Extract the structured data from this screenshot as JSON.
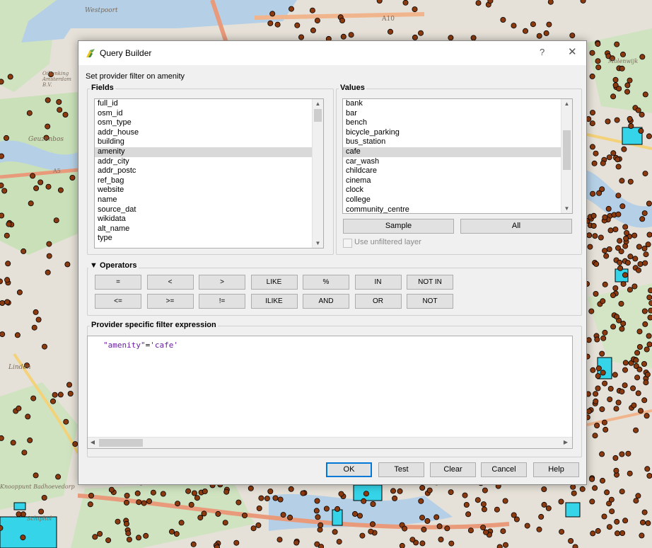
{
  "map": {
    "labels": [
      "Westpoort",
      "Oiltanking Amsterdam B.V.",
      "A10",
      "A5",
      "Geuzenbos",
      "Linden",
      "Knooppunt Badhoevedorp",
      "Schiphol",
      "Molenwijk"
    ]
  },
  "dialog": {
    "title": "Query Builder",
    "help_label": "?",
    "close_label": "✕",
    "subtitle": "Set provider filter on amenity",
    "fields": {
      "label": "Fields",
      "items": [
        "full_id",
        "osm_id",
        "osm_type",
        "addr_house",
        "building",
        "amenity",
        "addr_city",
        "addr_postc",
        "ref_bag",
        "website",
        "name",
        "source_dat",
        "wikidata",
        "alt_name",
        "type"
      ],
      "selected": "amenity"
    },
    "values": {
      "label": "Values",
      "items": [
        "bank",
        "bar",
        "bench",
        "bicycle_parking",
        "bus_station",
        "cafe",
        "car_wash",
        "childcare",
        "cinema",
        "clock",
        "college",
        "community_centre"
      ],
      "selected": "cafe",
      "sample_label": "Sample",
      "all_label": "All",
      "use_unfiltered_label": "Use unfiltered layer"
    },
    "operators": {
      "label": "Operators",
      "row1": [
        "=",
        "<",
        ">",
        "LIKE",
        "%",
        "IN",
        "NOT IN"
      ],
      "row2": [
        "<=",
        ">=",
        "!=",
        "ILIKE",
        "AND",
        "OR",
        "NOT"
      ]
    },
    "expression": {
      "label": "Provider specific filter expression",
      "field": "\"amenity\"",
      "op": "=",
      "value": "'cafe'"
    },
    "buttons": {
      "ok": "OK",
      "test": "Test",
      "clear": "Clear",
      "cancel": "Cancel",
      "help": "Help"
    }
  },
  "colors": {
    "poi_dot": "#8b3a0f",
    "building_fill": "#35d4e8",
    "accent": "#0078d7"
  }
}
